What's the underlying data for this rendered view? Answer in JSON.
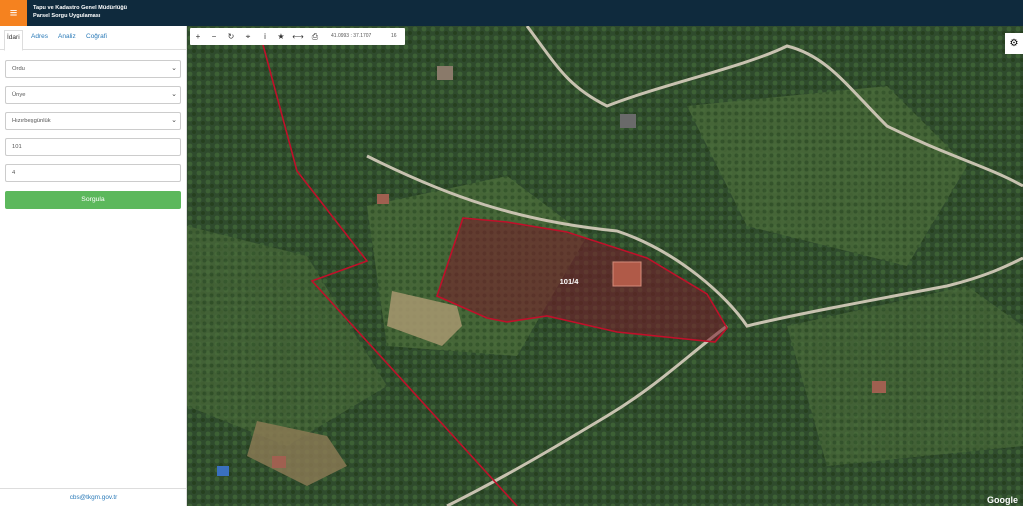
{
  "header": {
    "menu_icon": "≡",
    "title_line1": "Tapu ve Kadastro Genel Müdürlüğü",
    "title_line2": "Parsel Sorgu Uygulaması"
  },
  "sidebar": {
    "tabs": [
      {
        "label": "İdari"
      },
      {
        "label": "Adres"
      },
      {
        "label": "Analiz"
      },
      {
        "label": "Coğrafi"
      }
    ],
    "selects": [
      {
        "value": "Ordu"
      },
      {
        "value": "Ünye"
      },
      {
        "value": "Hızırbeşgünlük"
      }
    ],
    "inputs": [
      {
        "value": "101"
      },
      {
        "value": "4"
      }
    ],
    "submit_label": "Sorgula",
    "footer_email": "cbs@tkgm.gov.tr"
  },
  "toolbar": {
    "coords": "41.0993 : 37.1707",
    "zoom": "16"
  },
  "map": {
    "parcel_label": "101/4",
    "attribution": "Google",
    "parcel_color": "#c0102a"
  }
}
